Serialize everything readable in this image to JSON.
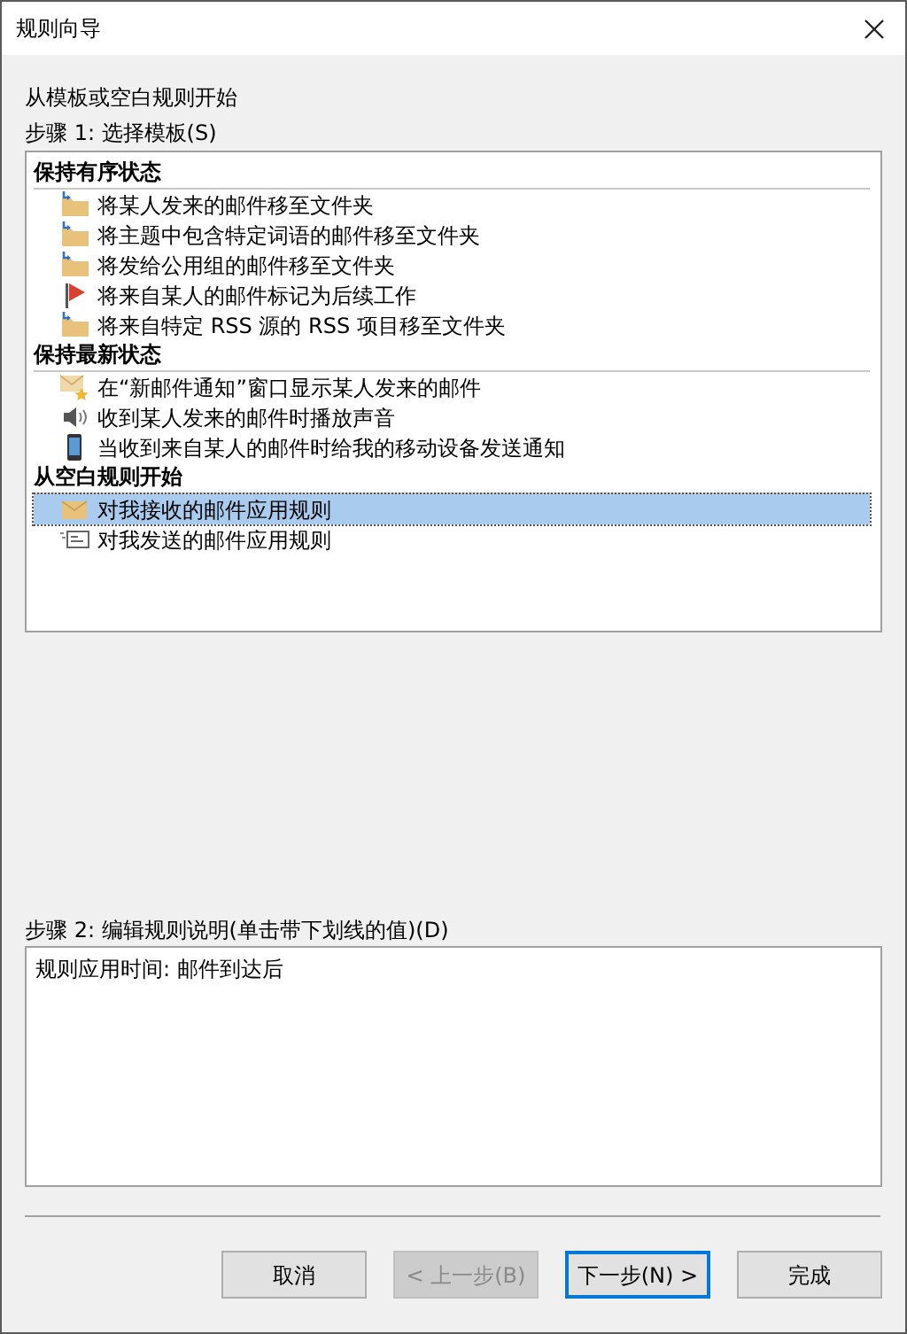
{
  "window": {
    "title": "规则向导"
  },
  "intro": "从模板或空白规则开始",
  "step1_label": "步骤 1: 选择模板(S)",
  "template_groups": [
    {
      "title": "保持有序状态",
      "items": [
        {
          "label": "将某人发来的邮件移至文件夹",
          "kind": "move",
          "selected": false
        },
        {
          "label": "将主题中包含特定词语的邮件移至文件夹",
          "kind": "move",
          "selected": false
        },
        {
          "label": "将发给公用组的邮件移至文件夹",
          "kind": "move",
          "selected": false
        },
        {
          "label": "将来自某人的邮件标记为后续工作",
          "kind": "flag",
          "selected": false
        },
        {
          "label": "将来自特定 RSS 源的 RSS 项目移至文件夹",
          "kind": "move",
          "selected": false
        }
      ]
    },
    {
      "title": "保持最新状态",
      "items": [
        {
          "label": "在“新邮件通知”窗口显示某人发来的邮件",
          "kind": "alert",
          "selected": false
        },
        {
          "label": "收到某人发来的邮件时播放声音",
          "kind": "sound",
          "selected": false
        },
        {
          "label": "当收到来自某人的邮件时给我的移动设备发送通知",
          "kind": "mobile",
          "selected": false
        }
      ]
    },
    {
      "title": "从空白规则开始",
      "items": [
        {
          "label": "对我接收的邮件应用规则",
          "kind": "incoming",
          "selected": true
        },
        {
          "label": "对我发送的邮件应用规则",
          "kind": "outgoing",
          "selected": false
        }
      ]
    }
  ],
  "step2_label": "步骤 2: 编辑规则说明(单击带下划线的值)(D)",
  "rule_description": "规则应用时间: 邮件到达后",
  "buttons": [
    {
      "label": "取消",
      "disabled": false,
      "default": false
    },
    {
      "label": "< 上一步(B)",
      "disabled": true,
      "default": false
    },
    {
      "label": "下一步(N) >",
      "disabled": false,
      "default": true
    },
    {
      "label": "完成",
      "disabled": false,
      "default": false
    }
  ]
}
